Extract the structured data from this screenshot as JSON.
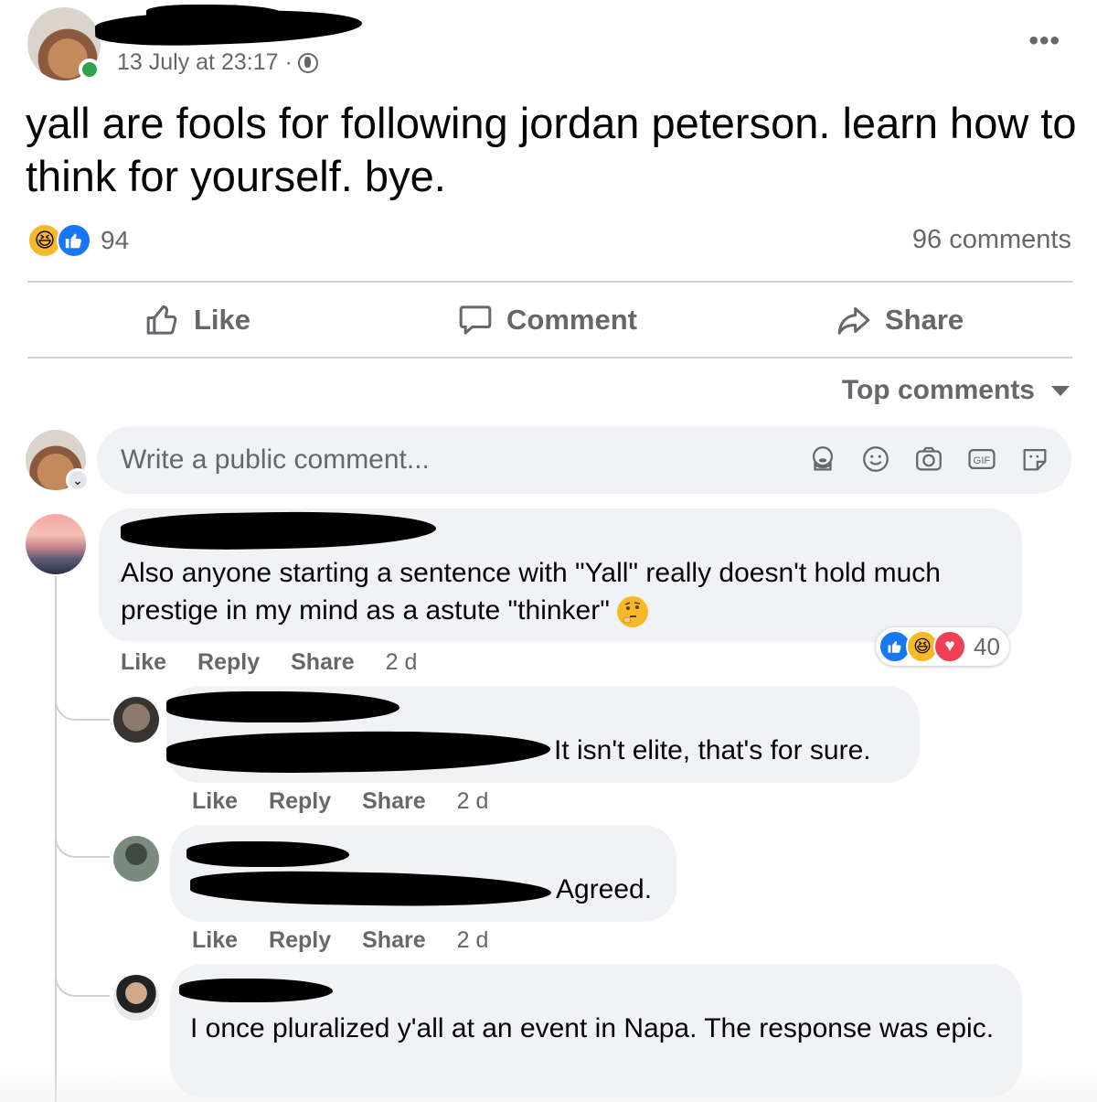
{
  "post": {
    "timestamp": "13 July at 23:17 ·",
    "text": "yall are fools for following jordan peterson. learn how to think for yourself. bye.",
    "reaction_count": "94",
    "comments_count": "96 comments"
  },
  "actions": {
    "like": "Like",
    "comment": "Comment",
    "share": "Share"
  },
  "sort_label": "Top comments",
  "composer": {
    "placeholder": "Write a public comment..."
  },
  "comments": [
    {
      "text": "Also anyone starting a sentence with \"Yall\" really doesn't hold much prestige in my mind as a astute \"thinker\"",
      "like": "Like",
      "reply": "Reply",
      "share": "Share",
      "time": "2 d",
      "reaction_count": "40"
    },
    {
      "text": "It isn't elite, that's for sure.",
      "like": "Like",
      "reply": "Reply",
      "share": "Share",
      "time": "2 d"
    },
    {
      "text": "Agreed.",
      "like": "Like",
      "reply": "Reply",
      "share": "Share",
      "time": "2 d"
    },
    {
      "text": "I once pluralized y'all at an event in Napa. The response was epic."
    }
  ],
  "icons": {
    "more": "more-options-icon",
    "privacy": "globe-icon",
    "like": "thumbs-up-icon",
    "comment": "speech-bubble-icon",
    "share": "share-arrow-icon",
    "composer": [
      "avatar-sticker-icon",
      "smiley-icon",
      "camera-icon",
      "gif-icon",
      "sticker-icon"
    ]
  },
  "colors": {
    "like_blue": "#1877f2",
    "haha_yellow": "#f7b928",
    "love_red": "#f33e58",
    "online_green": "#31a24c",
    "muted_text": "#65676b",
    "bubble_bg": "#f0f2f5"
  }
}
